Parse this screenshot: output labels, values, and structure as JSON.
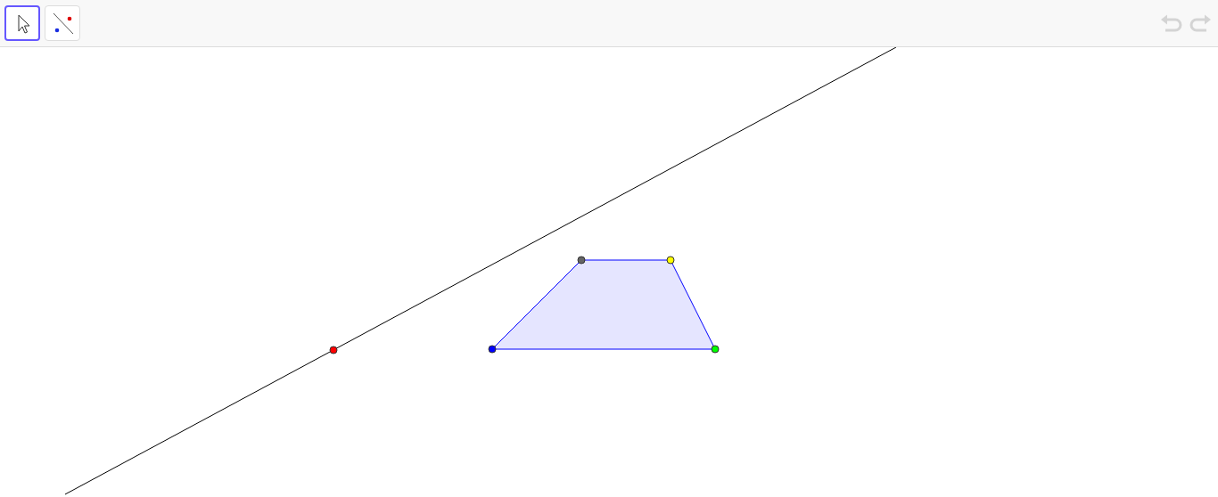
{
  "toolbar": {
    "tools": [
      {
        "kind": "move",
        "selected": true
      },
      {
        "kind": "line",
        "selected": false
      }
    ],
    "undo": {
      "disabled": true
    },
    "redo": {
      "disabled": true
    }
  },
  "canvas": {
    "line": {
      "point": {
        "color": "#ff0000"
      }
    },
    "polygon": {
      "vertices": [
        {
          "color": "#0000ff"
        },
        {
          "color": "#646464"
        },
        {
          "color": "#ffff00"
        },
        {
          "color": "#00ff00"
        }
      ]
    }
  }
}
